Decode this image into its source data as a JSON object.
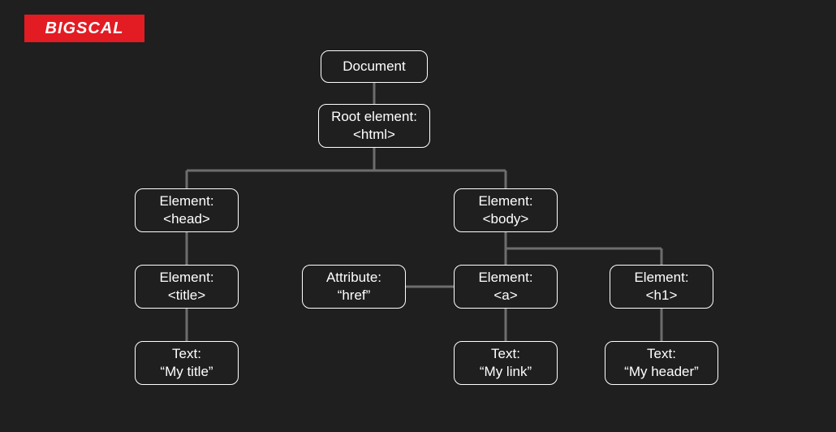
{
  "brand": {
    "name": "BIGSCAL"
  },
  "colors": {
    "bg": "#1f1f1f",
    "accent": "#e31b23",
    "fg": "#ffffff",
    "line": "#6d6d6d"
  },
  "diagram": {
    "document": {
      "label": "Document"
    },
    "root": {
      "line1": "Root element:",
      "line2": "<html>"
    },
    "head": {
      "line1": "Element:",
      "line2": "<head>"
    },
    "body": {
      "line1": "Element:",
      "line2": "<body>"
    },
    "title": {
      "line1": "Element:",
      "line2": "<title>"
    },
    "attr": {
      "line1": "Attribute:",
      "line2": "“href”"
    },
    "a": {
      "line1": "Element:",
      "line2": "<a>"
    },
    "h1": {
      "line1": "Element:",
      "line2": "<h1>"
    },
    "text_title": {
      "line1": "Text:",
      "line2": "“My title”"
    },
    "text_link": {
      "line1": "Text:",
      "line2": "“My link”"
    },
    "text_header": {
      "line1": "Text:",
      "line2": "“My header”"
    }
  }
}
